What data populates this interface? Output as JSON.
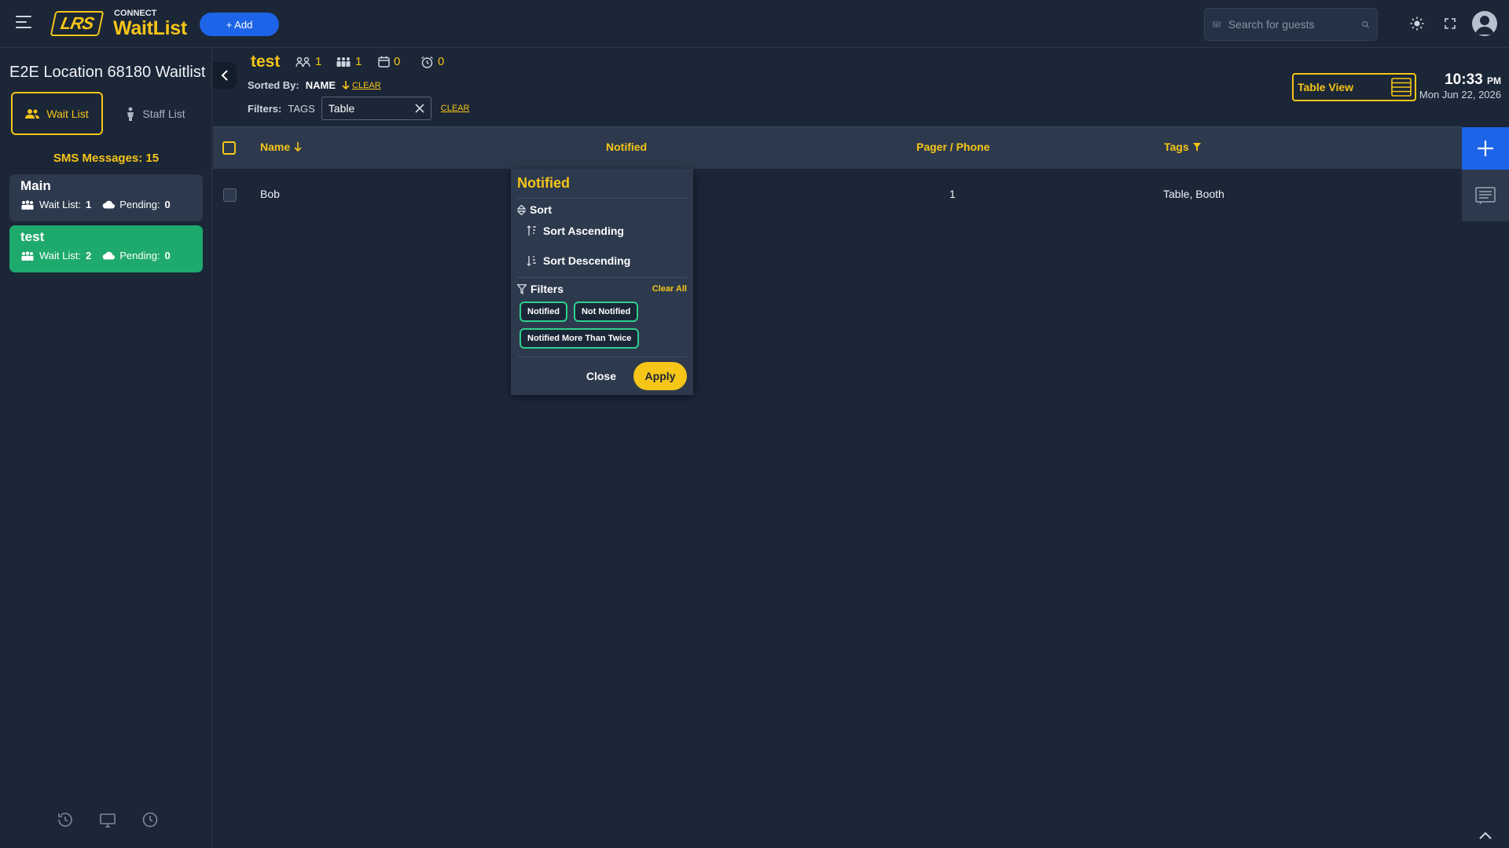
{
  "header": {
    "brand_top": "CONNECT",
    "brand_main": "WaitList",
    "logo_text": "LRS",
    "add_label": "+ Add",
    "search_placeholder": "Search for guests"
  },
  "sidebar": {
    "location_title": "E2E Location 68180 Waitlist",
    "tabs": [
      {
        "label": "Wait List",
        "active": true
      },
      {
        "label": "Staff List",
        "active": false
      }
    ],
    "sms_label": "SMS Messages: 15",
    "waitlists": [
      {
        "name": "Main",
        "waitlist_label": "Wait List:",
        "waitlist_count": "1",
        "pending_label": "Pending:",
        "pending_count": "0"
      },
      {
        "name": "test",
        "waitlist_label": "Wait List:",
        "waitlist_count": "2",
        "pending_label": "Pending:",
        "pending_count": "0"
      }
    ]
  },
  "main": {
    "title": "test",
    "stats": [
      "1",
      "1",
      "0",
      "0"
    ],
    "sorted_by_label": "Sorted By:",
    "sorted_by_value": "NAME",
    "clear_label": "CLEAR",
    "filters_label": "Filters:",
    "filter_tag": "TAGS",
    "filter_value": "Table",
    "view_button": "Table View",
    "time": "10:33",
    "time_suffix": "PM",
    "date": "Mon Jun 22, 2026"
  },
  "table": {
    "columns": [
      "Name",
      "Notified",
      "Pager / Phone",
      "Tags"
    ],
    "rows": [
      {
        "name": "Bob",
        "notified": "",
        "pager": "1",
        "tags": "Table, Booth"
      }
    ]
  },
  "popup": {
    "title": "Notified",
    "sort_label": "Sort",
    "sort_asc": "Sort Ascending",
    "sort_desc": "Sort Descending",
    "filters_label": "Filters",
    "clear_all": "Clear All",
    "chips": [
      "Notified",
      "Not Notified",
      "Notified More Than Twice"
    ],
    "close_label": "Close",
    "apply_label": "Apply"
  },
  "colors": {
    "accent": "#f5c518",
    "primary_blue": "#1d64e8",
    "active_card": "#1eaa6c",
    "background": "#1b2637",
    "chip_border": "#2fcf8e"
  }
}
